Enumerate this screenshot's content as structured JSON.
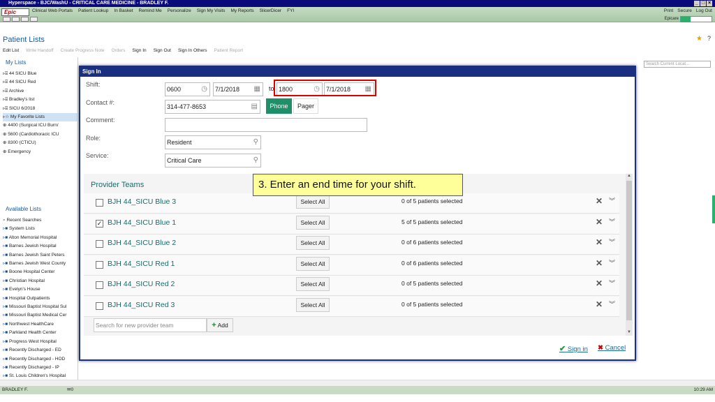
{
  "window": {
    "title": "Hyperspace - BJC/WashU - CRITICAL CARE MEDICINE - BRADLEY F."
  },
  "toolbar": {
    "epic_label": "Epic",
    "items": [
      "Clinical Web Portals",
      "Patient Lookup",
      "In Basket",
      "Remind Me",
      "Personalize",
      "Sign My Visits",
      "My Reports",
      "SlicerDicer",
      "FYI"
    ],
    "right_items": [
      "Print",
      "Secure",
      "Log Out"
    ],
    "epicare_label": "Epicare"
  },
  "page": {
    "title": "Patient Lists",
    "actions": [
      "Edit List",
      "Write Handoff",
      "Create Progress Note",
      "Orders",
      "Sign In",
      "Sign Out",
      "Sign In Others",
      "Patient Report"
    ],
    "search_placeholder": "Search Current Locat..."
  },
  "my_lists": {
    "title": "My Lists",
    "items": [
      "44 SICU Blue",
      "44 SICU Red",
      "Archive",
      "Bradley's list",
      "SICU 6/2018",
      "My Favorite Lists",
      "4400 (Surgical ICU Burn/",
      "5600 (Cardiothoracic ICU",
      "8300 (CTICU)",
      "Emergency"
    ]
  },
  "available_lists": {
    "title": "Available Lists",
    "items": [
      "Recent Searches",
      "System Lists",
      "Alton Memorial Hospital",
      "Barnes Jewish Hospital",
      "Barnes Jewish Saint Peters",
      "Barnes Jewish West County",
      "Boone Hospital Center",
      "Christian Hospital",
      "Evelyn's House",
      "Hospital Outpatients",
      "Missouri Baptist Hospital Sul",
      "Missouri Baptist Medical Cer",
      "Northwest HealthCare",
      "Parkland Health Center",
      "Progress West Hospital",
      "Recently Discharged - ED",
      "Recently Discharged - HOD",
      "Recently Discharged - IP",
      "St. Louis Children's Hospital"
    ]
  },
  "dialog": {
    "title": "Sign In",
    "shift_label": "Shift:",
    "shift_start_time": "0600",
    "shift_start_date": "7/1/2018",
    "to_label": "to",
    "shift_end_time": "1800",
    "shift_end_date": "7/1/2018",
    "contact_label": "Contact #:",
    "contact_value": "314-477-8653",
    "phone_label": "Phone",
    "pager_label": "Pager",
    "comment_label": "Comment:",
    "comment_value": "",
    "role_label": "Role:",
    "role_value": "Resident",
    "service_label": "Service:",
    "service_value": "Critical Care",
    "provider_teams_title": "Provider Teams",
    "teams": [
      {
        "name": "BJH 44_SICU Blue 3",
        "checked": false,
        "select_all": "Select All",
        "count": "0 of 5 patients selected"
      },
      {
        "name": "BJH 44_SICU Blue 1",
        "checked": true,
        "select_all": "Select All",
        "count": "5 of 5 patients selected"
      },
      {
        "name": "BJH 44_SICU Blue 2",
        "checked": false,
        "select_all": "Select All",
        "count": "0 of 6 patients selected"
      },
      {
        "name": "BJH 44_SICU Red 1",
        "checked": false,
        "select_all": "Select All",
        "count": "0 of 6 patients selected"
      },
      {
        "name": "BJH 44_SICU Red 2",
        "checked": false,
        "select_all": "Select All",
        "count": "0 of 5 patients selected"
      },
      {
        "name": "BJH 44_SICU Red 3",
        "checked": false,
        "select_all": "Select All",
        "count": "0 of 5 patients selected"
      }
    ],
    "search_team_placeholder": "Search for new provider team",
    "add_label": "Add",
    "sign_in_label": "Sign in",
    "cancel_label": "Cancel"
  },
  "callout": {
    "text": "3. Enter an end time for your shift."
  },
  "status": {
    "user": "BRADLEY F.",
    "count": "0",
    "time": "10:29 AM"
  },
  "colors": {
    "accent": "#1f8f6a",
    "title_bar": "#1a2f80",
    "highlight": "#dd0000",
    "callout_bg": "#ffff99"
  }
}
